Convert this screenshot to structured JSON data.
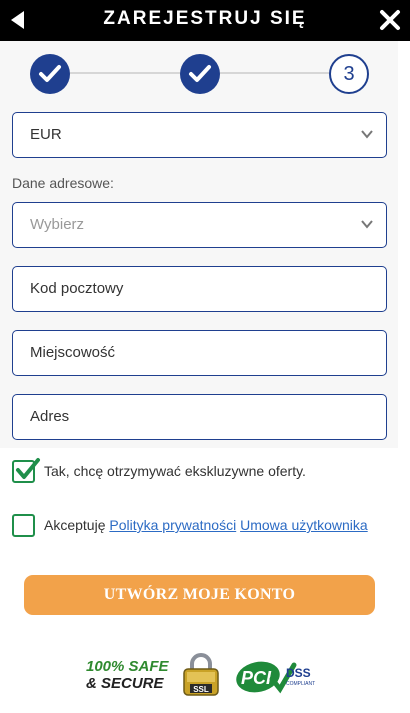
{
  "header": {
    "title": "ZAREJESTRUJ SIĘ"
  },
  "stepper": {
    "current_step_number": "3"
  },
  "form": {
    "currency_value": "EUR",
    "address_section_label": "Dane adresowe:",
    "country_placeholder": "Wybierz",
    "postal_code_placeholder": "Kod pocztowy",
    "city_placeholder": "Miejscowość",
    "address_placeholder": "Adres"
  },
  "consents": {
    "offers_label": "Tak, chcę otrzymywać ekskluzywne oferty.",
    "offers_checked": true,
    "terms_prefix": "Akceptuję",
    "privacy_link": "Polityka prywatności",
    "agreement_link": "Umowa użytkownika",
    "terms_checked": false
  },
  "cta": {
    "label": "UTWÓRZ MOJE KONTO"
  },
  "badges": {
    "safe_line1": "100% SAFE",
    "safe_line2": "& SECURE",
    "ssl_text": "SSL",
    "pci_text": "PCI",
    "dss_text": "DSS",
    "dss_sub": "COMPLIANT"
  },
  "colors": {
    "header_bg": "#000000",
    "primary_blue": "#1f3f8f",
    "check_green": "#1f8f4a",
    "cta_orange": "#f2a24a",
    "link_blue": "#2c6bc4"
  }
}
